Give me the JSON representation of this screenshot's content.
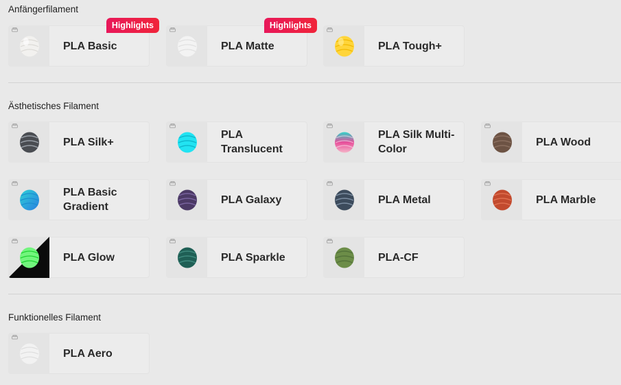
{
  "sections": [
    {
      "title": "Anfängerfilament",
      "items": [
        {
          "label": "PLA Basic",
          "badge": "Highlights",
          "icon": "white-spool-icon",
          "color": "#f2f1ef"
        },
        {
          "label": "PLA Matte",
          "badge": "Highlights",
          "icon": "white-spool-icon",
          "color": "#f3f3f3"
        },
        {
          "label": "PLA Tough+",
          "icon": "yellow-spool-icon",
          "color": "#ffd53a"
        }
      ]
    },
    {
      "title": "Ästhetisches Filament",
      "items": [
        {
          "label": "PLA Silk+",
          "icon": "grey-silk-spool-icon",
          "color": "#4a4d52"
        },
        {
          "label": "PLA Translucent",
          "icon": "cyan-spool-icon",
          "color": "#22e3f2"
        },
        {
          "label": "PLA Silk Multi-Color",
          "icon": "multicolor-spool-icon",
          "color": "#e84d9a"
        },
        {
          "label": "PLA Wood",
          "icon": "wood-spool-icon",
          "color": "#6d5344"
        },
        {
          "label": "PLA Basic Gradient",
          "icon": "gradient-spool-icon",
          "color": "#2fb4e6"
        },
        {
          "label": "PLA Galaxy",
          "icon": "galaxy-spool-icon",
          "color": "#4c3a66"
        },
        {
          "label": "PLA Metal",
          "icon": "metal-spool-icon",
          "color": "#3c4b5c"
        },
        {
          "label": "PLA Marble",
          "icon": "marble-spool-icon",
          "color": "#c24a2e"
        },
        {
          "label": "PLA Glow",
          "icon": "glow-spool-icon",
          "color": "#4cf55a"
        },
        {
          "label": "PLA Sparkle",
          "icon": "sparkle-spool-icon",
          "color": "#1f5f55"
        },
        {
          "label": "PLA-CF",
          "icon": "green-cf-spool-icon",
          "color": "#6c8d48"
        }
      ]
    },
    {
      "title": "Funktionelles Filament",
      "items": [
        {
          "label": "PLA Aero",
          "icon": "white-spool-icon",
          "color": "#f2f2f2"
        }
      ]
    }
  ]
}
